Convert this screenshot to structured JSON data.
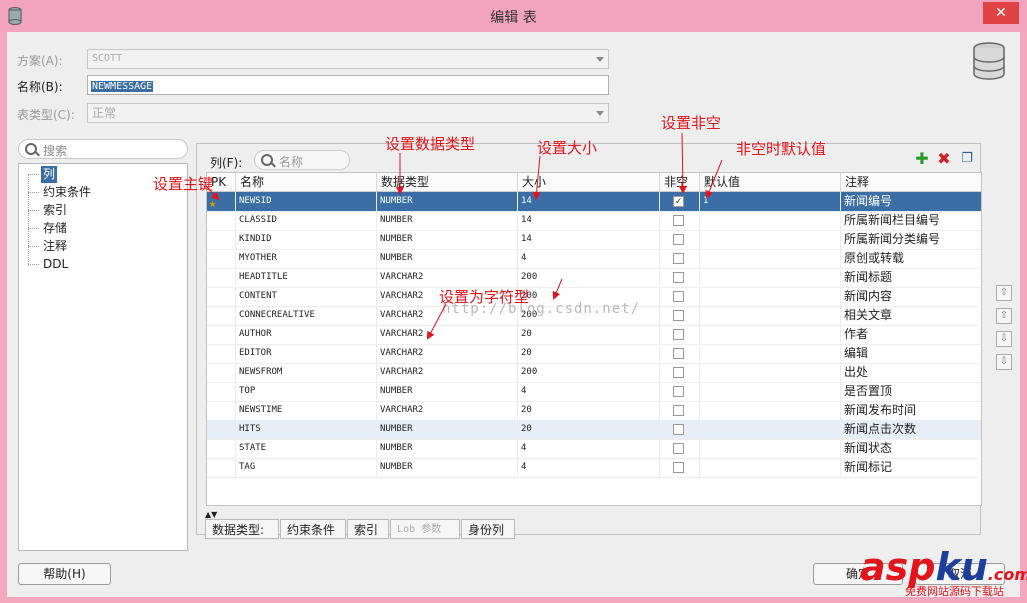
{
  "window": {
    "title": "编辑 表",
    "close_icon": "close-icon"
  },
  "form": {
    "schema_label": "方案(A):",
    "schema_value": "SCOTT",
    "name_label": "名称(B):",
    "name_value": "NEWMESSAGE",
    "type_label": "表类型(C):",
    "type_value": "正常"
  },
  "sidebar": {
    "search_placeholder": "搜索",
    "items": [
      "列",
      "约束条件",
      "索引",
      "存储",
      "注释",
      "DDL"
    ]
  },
  "columns_panel": {
    "filter_label": "列(F):",
    "filter_placeholder": "名称",
    "headers": [
      "PK",
      "名称",
      "数据类型",
      "大小",
      "非空",
      "默认值",
      "注释"
    ],
    "rows": [
      {
        "name": "NEWSID",
        "type": "NUMBER",
        "size": "14",
        "notnull": true,
        "default": "1",
        "comment": "新闻编号"
      },
      {
        "name": "CLASSID",
        "type": "NUMBER",
        "size": "14",
        "notnull": false,
        "default": "",
        "comment": "所属新闻栏目编号"
      },
      {
        "name": "KINDID",
        "type": "NUMBER",
        "size": "14",
        "notnull": false,
        "default": "",
        "comment": "所属新闻分类编号"
      },
      {
        "name": "MYOTHER",
        "type": "NUMBER",
        "size": "4",
        "notnull": false,
        "default": "",
        "comment": "原创或转载"
      },
      {
        "name": "HEADTITLE",
        "type": "VARCHAR2",
        "size": "200",
        "notnull": false,
        "default": "",
        "comment": "新闻标题"
      },
      {
        "name": "CONTENT",
        "type": "VARCHAR2",
        "size": "200",
        "notnull": false,
        "default": "",
        "comment": "新闻内容"
      },
      {
        "name": "CONNECREALTIVE",
        "type": "VARCHAR2",
        "size": "200",
        "notnull": false,
        "default": "",
        "comment": "相关文章"
      },
      {
        "name": "AUTHOR",
        "type": "VARCHAR2",
        "size": "20",
        "notnull": false,
        "default": "",
        "comment": "作者"
      },
      {
        "name": "EDITOR",
        "type": "VARCHAR2",
        "size": "20",
        "notnull": false,
        "default": "",
        "comment": "编辑"
      },
      {
        "name": "NEWSFROM",
        "type": "VARCHAR2",
        "size": "200",
        "notnull": false,
        "default": "",
        "comment": "出处"
      },
      {
        "name": "TOP",
        "type": "NUMBER",
        "size": "4",
        "notnull": false,
        "default": "",
        "comment": "是否置顶"
      },
      {
        "name": "NEWSTIME",
        "type": "VARCHAR2",
        "size": "20",
        "notnull": false,
        "default": "",
        "comment": "新闻发布时间"
      },
      {
        "name": "HITS",
        "type": "NUMBER",
        "size": "20",
        "notnull": false,
        "default": "",
        "comment": "新闻点击次数"
      },
      {
        "name": "STATE",
        "type": "NUMBER",
        "size": "4",
        "notnull": false,
        "default": "",
        "comment": "新闻状态"
      },
      {
        "name": "TAG",
        "type": "NUMBER",
        "size": "4",
        "notnull": false,
        "default": "",
        "comment": "新闻标记"
      }
    ]
  },
  "bottom_tabs": [
    "数据类型:",
    "约束条件",
    "索引",
    "Lob 参数",
    "身份列"
  ],
  "buttons": {
    "help": "帮助(H)",
    "ok": "确定",
    "cancel": "取消"
  },
  "annotations": {
    "set_pk": "设置主键",
    "set_type": "设置数据类型",
    "set_size": "设置大小",
    "set_notnull": "设置非空",
    "notnull_default": "非空时默认值",
    "set_varchar": "设置为字符型"
  },
  "watermark": "http://blog.csdn.net/",
  "logo": {
    "part1": "asp",
    "part2": "ku",
    "suffix": ".com",
    "sub": "免费网站源码下载站"
  },
  "colors": {
    "selection": "#3a6ea5",
    "annotation": "#e3141b",
    "titlebar": "#f2a3bd"
  }
}
